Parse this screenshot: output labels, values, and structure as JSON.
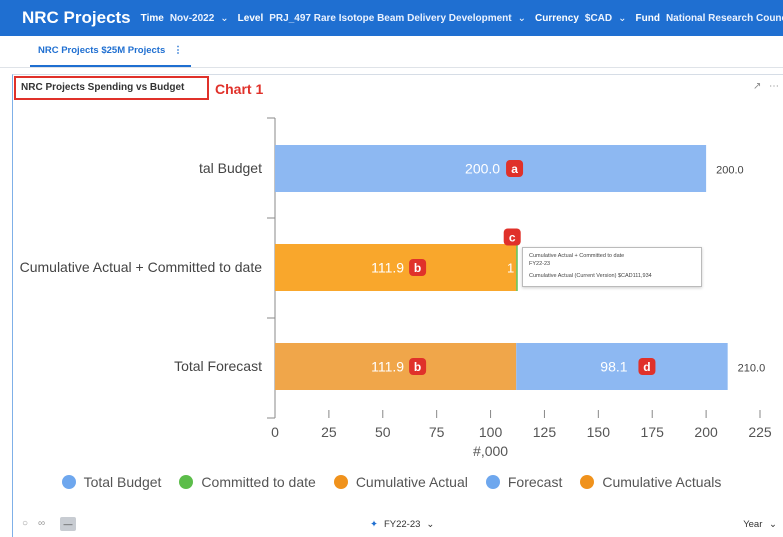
{
  "topbar": {
    "title": "NRC Projects",
    "filters": [
      {
        "label": "Time",
        "value": "Nov-2022",
        "has_dropdown": true
      },
      {
        "label": "Level",
        "value": "PRJ_497 Rare Isotope Beam Delivery Development",
        "has_dropdown": true
      },
      {
        "label": "Currency",
        "value": "$CAD",
        "has_dropdown": true
      },
      {
        "label": "Fund",
        "value": "National Research Council Fund",
        "has_dropdown": true
      }
    ]
  },
  "tabs": [
    {
      "label": "NRC Projects $25M Projects",
      "menu_icon": "⋮"
    }
  ],
  "panel": {
    "title": "NRC Projects Spending vs Budget",
    "annotation": "Chart 1"
  },
  "chart_data": {
    "type": "bar",
    "orientation": "horizontal",
    "stacked": true,
    "categories": [
      "tal Budget",
      "Cumulative Actual + Committed to date",
      "Total Forecast"
    ],
    "xlabel": "#,000",
    "xlim": [
      0,
      225
    ],
    "xticks": [
      0,
      25,
      50,
      75,
      100,
      125,
      150,
      175,
      200,
      225
    ],
    "series": [
      {
        "name": "Total Budget",
        "color": "#8db8f2",
        "values": [
          200.0,
          null,
          null
        ],
        "labels": [
          "200.0",
          null,
          null
        ]
      },
      {
        "name": "Committed to date",
        "color": "#5cbd4a",
        "values": [
          null,
          0.5,
          null
        ],
        "labels": [
          null,
          null,
          null
        ]
      },
      {
        "name": "Cumulative Actual",
        "color": "#f9a72c",
        "values": [
          null,
          111.9,
          null
        ],
        "labels": [
          null,
          "111.9",
          null
        ]
      },
      {
        "name": "Forecast",
        "color": "#8db8f2",
        "values": [
          null,
          null,
          98.1
        ],
        "labels": [
          null,
          null,
          "98.1"
        ]
      },
      {
        "name": "Cumulative Actuals",
        "color": "#f0a64a",
        "values": [
          null,
          null,
          111.9
        ],
        "labels": [
          null,
          null,
          "111.9"
        ]
      }
    ],
    "totals": [
      "200.0",
      "1",
      "210.0"
    ],
    "annotations": [
      "a",
      "b",
      "c",
      "b",
      "d"
    ],
    "tooltip": {
      "title": "Cumulative Actual + Committed to date",
      "period": "FY22-23",
      "detail": "Cumulative Actual (Current Version)  $CAD111,934"
    }
  },
  "legend": [
    {
      "label": "Total Budget",
      "color": "#6ea7ee"
    },
    {
      "label": "Committed to date",
      "color": "#5cbd4a"
    },
    {
      "label": "Cumulative Actual",
      "color": "#f0921c"
    },
    {
      "label": "Forecast",
      "color": "#6ea7ee"
    },
    {
      "label": "Cumulative Actuals",
      "color": "#f0921c"
    }
  ],
  "footer": {
    "period": "FY22-23",
    "granularity": "Year"
  }
}
